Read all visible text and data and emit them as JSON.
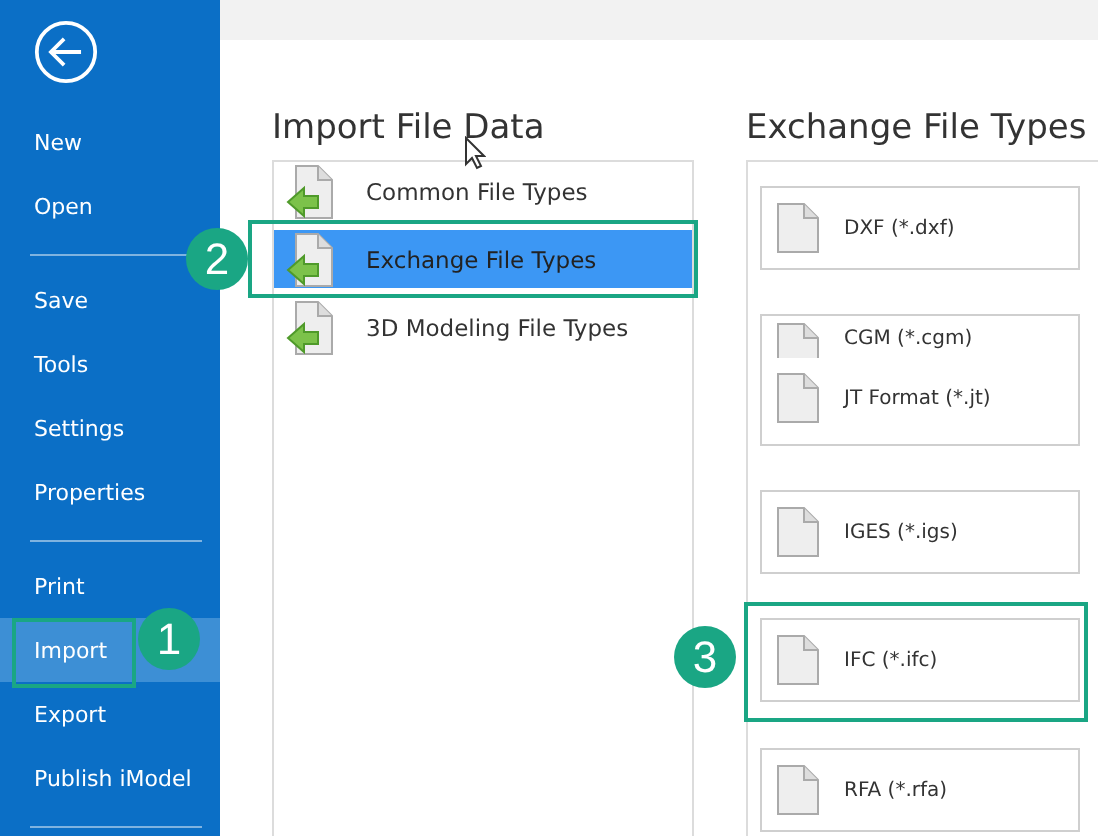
{
  "sidebar": {
    "groups": [
      [
        {
          "label": "New",
          "selected": false
        },
        {
          "label": "Open",
          "selected": false
        }
      ],
      [
        {
          "label": "Save",
          "selected": false
        },
        {
          "label": "Tools",
          "selected": false
        },
        {
          "label": "Settings",
          "selected": false
        },
        {
          "label": "Properties",
          "selected": false
        }
      ],
      [
        {
          "label": "Print",
          "selected": false
        },
        {
          "label": "Import",
          "selected": true,
          "callout": "1"
        },
        {
          "label": "Export",
          "selected": false
        },
        {
          "label": "Publish iModel",
          "selected": false
        }
      ]
    ]
  },
  "import_panel": {
    "title": "Import File Data",
    "categories": [
      {
        "label": "Common File Types",
        "selected": false
      },
      {
        "label": "Exchange File Types",
        "selected": true,
        "callout": "2"
      },
      {
        "label": "3D Modeling File Types",
        "selected": false
      }
    ]
  },
  "exchange_panel": {
    "title": "Exchange File Types",
    "file_types": [
      {
        "label": "DXF (*.dxf)",
        "kind": "card"
      },
      {
        "label": "CGM (*.cgm)",
        "kind": "covered"
      },
      {
        "label": "JT Format (*.jt)",
        "kind": "overlay"
      },
      {
        "label": "IGES (*.igs)",
        "kind": "card"
      },
      {
        "label": "IFC (*.ifc)",
        "kind": "card",
        "callout": "3"
      },
      {
        "label": "RFA (*.rfa)",
        "kind": "card"
      }
    ]
  }
}
